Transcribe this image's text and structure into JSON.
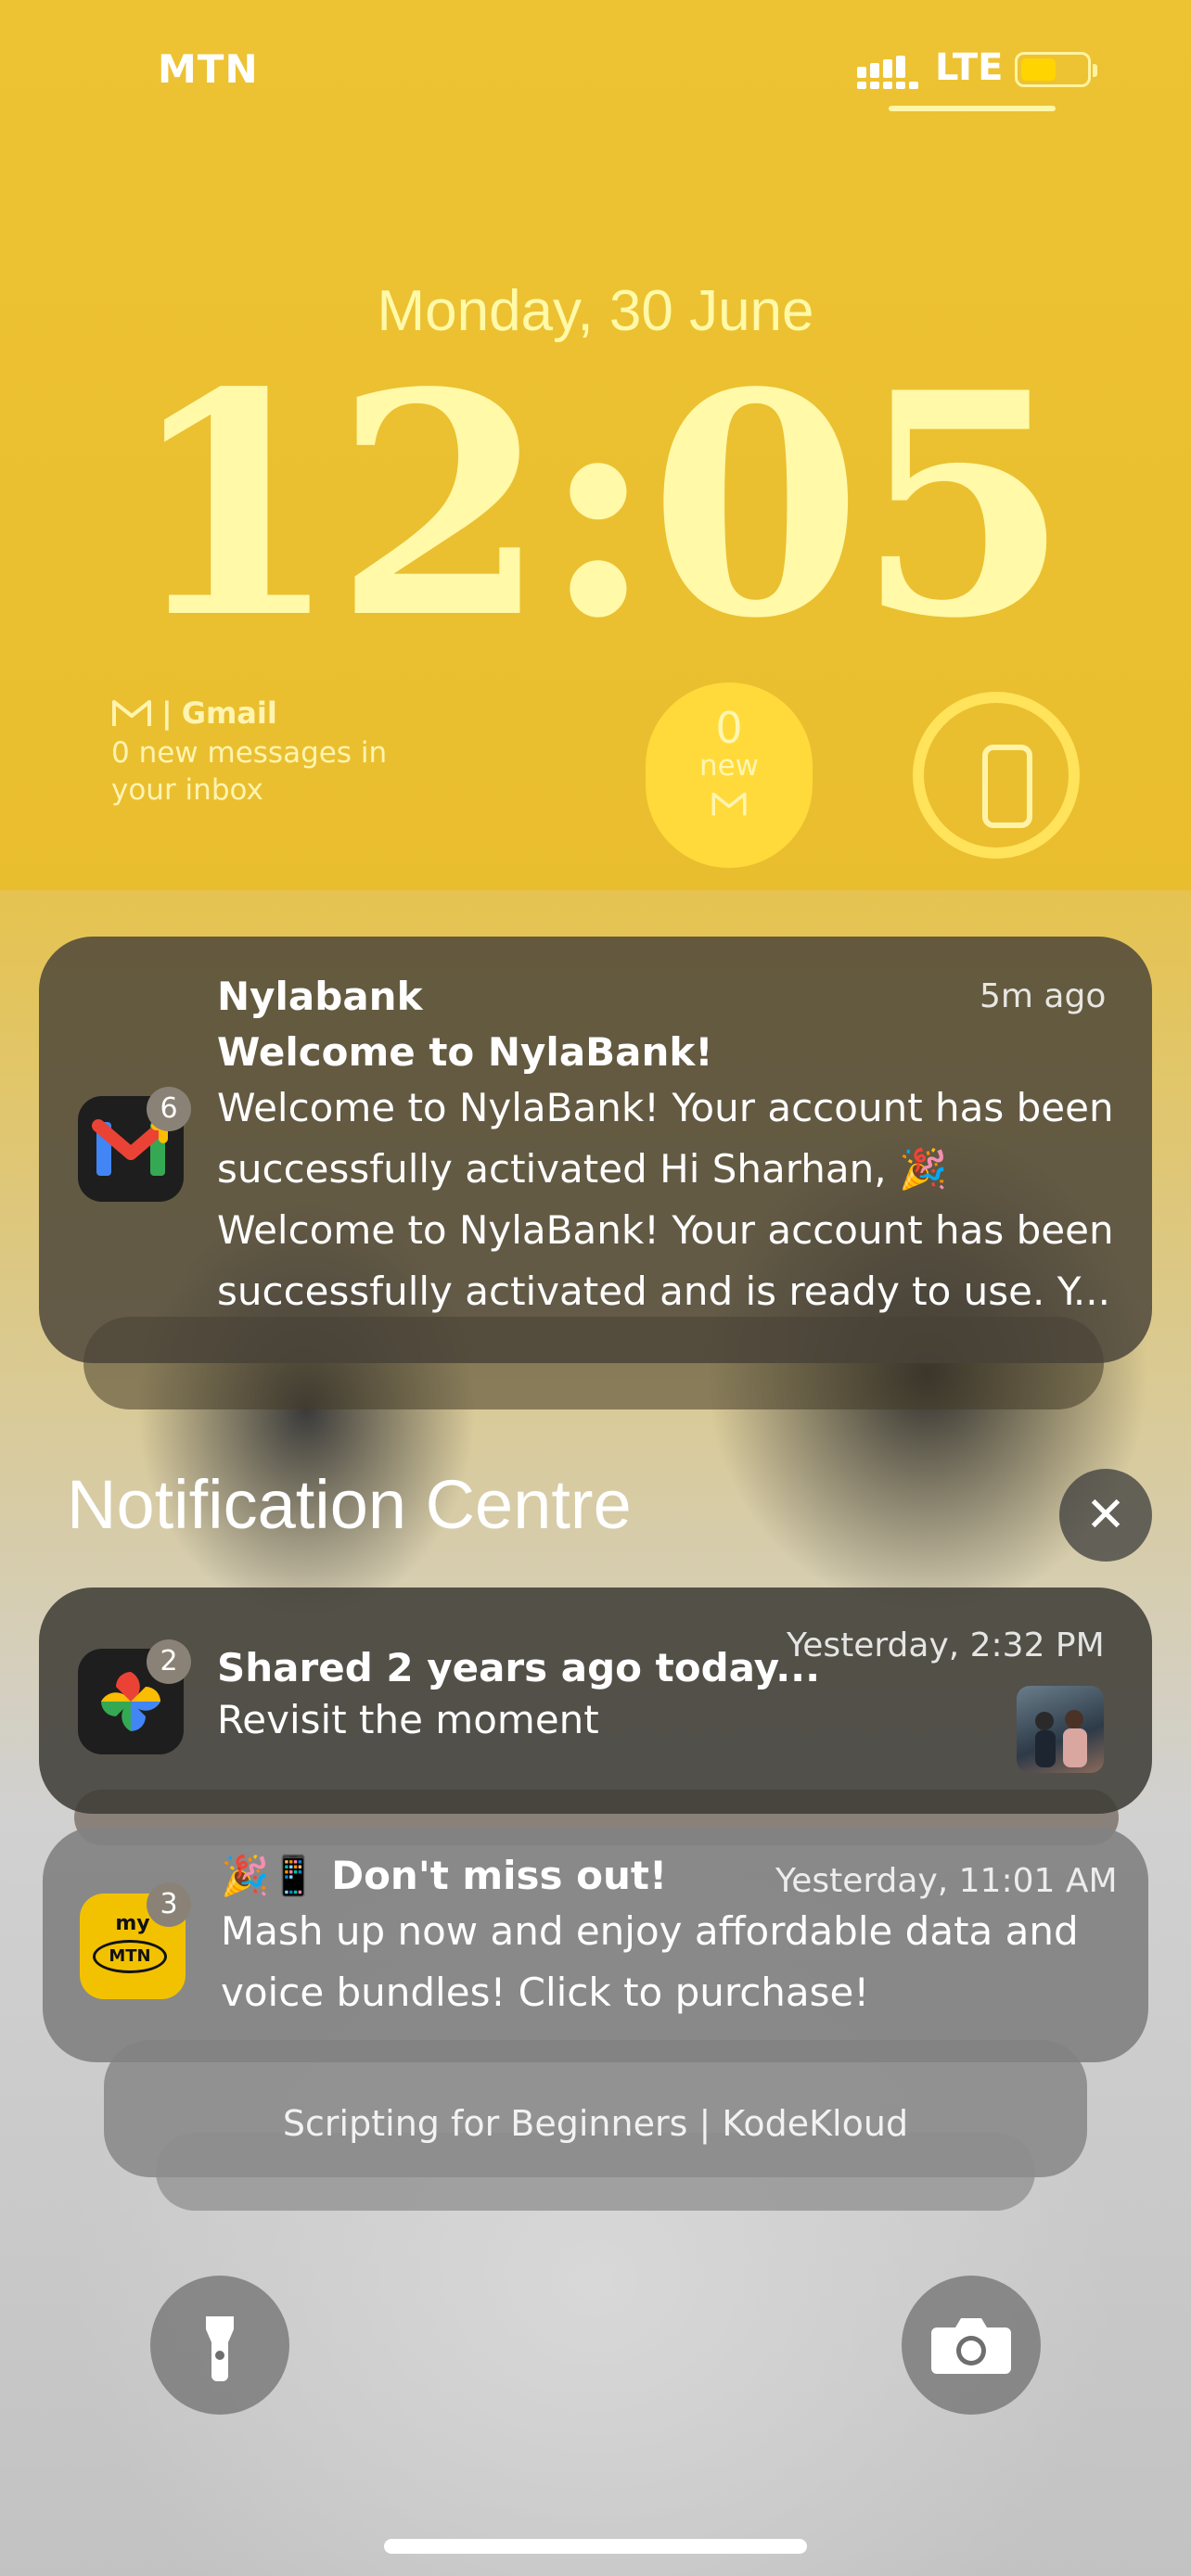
{
  "status_bar": {
    "carrier": "MTN",
    "network": "LTE",
    "battery_level": 0.55
  },
  "lock_screen": {
    "date": "Monday, 30 June",
    "time": "12:05"
  },
  "widgets": {
    "gmail": {
      "app_name": "Gmail",
      "message": "0 new messages in your inbox"
    },
    "gmail_count": {
      "count": "0",
      "label": "new"
    },
    "battery_ring": {
      "icon": "phone-icon",
      "level": 0.9
    }
  },
  "notifications": [
    {
      "app": "Gmail",
      "icon": "gmail-icon",
      "badge": "6",
      "sender": "Nylabank",
      "time": "5m ago",
      "title": "Welcome to NylaBank!",
      "body_line1": "Welcome to NylaBank! Your account has been",
      "body_line2": "successfully activated Hi Sharhan, 🎉",
      "body_line3": "Welcome to NylaBank! Your account has been",
      "body_line4": "successfully activated and is ready to use. Y..."
    }
  ],
  "notification_centre": {
    "title": "Notification Centre",
    "close_label": "✕",
    "items": [
      {
        "app": "Google Photos",
        "icon": "google-photos-icon",
        "badge": "2",
        "title": "Shared 2 years ago today...",
        "time": "Yesterday, 2:32 PM",
        "body": "Revisit the moment"
      },
      {
        "app": "myMTN",
        "icon": "mymtn-icon",
        "icon_text_top": "my",
        "icon_text_bottom": "MTN",
        "badge": "3",
        "title": "🎉📱 Don't miss out!",
        "time": "Yesterday, 11:01 AM",
        "body_line1": " Mash up now and enjoy affordable data and",
        "body_line2": "voice bundles! Click to purchase!"
      }
    ],
    "stacked_preview": "Scripting for Beginners | KodeKloud"
  },
  "bottom_controls": {
    "left": "flashlight-icon",
    "right": "camera-icon"
  },
  "colors": {
    "wallpaper_yellow": "#ecc130",
    "clock_yellow": "#fff9a8",
    "widget_yellow": "#ffda3a"
  }
}
